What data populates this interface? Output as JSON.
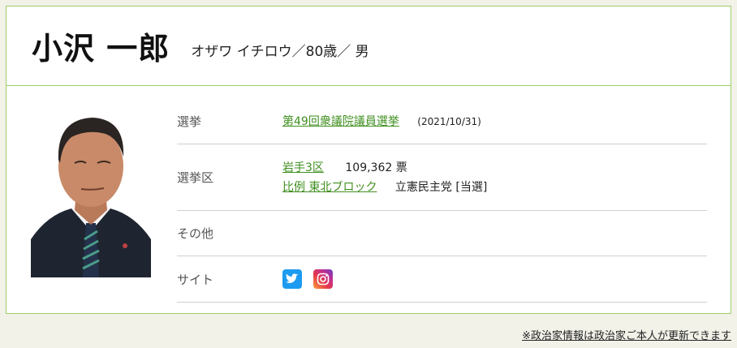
{
  "header": {
    "name": "小沢 一郎",
    "kana_age_gender": "オザワ イチロウ／80歳／ 男"
  },
  "profile": {
    "rows": [
      {
        "label": "選挙",
        "election_link": "第49回衆議院議員選挙",
        "election_date": "(2021/10/31)"
      },
      {
        "label": "選挙区",
        "district_link": "岩手3区",
        "district_votes": "109,362 票",
        "pr_link": "比例 東北ブロック",
        "pr_party": "立憲民主党 [当選]"
      },
      {
        "label": "その他"
      },
      {
        "label": "サイト",
        "sns": [
          "twitter-icon",
          "instagram-icon"
        ]
      }
    ]
  },
  "footnote": "※政治家情報は政治家ご本人が更新できます",
  "colors": {
    "accent_green": "#3f8f1f",
    "border_green": "#9ccf6b",
    "background": "#f2f2e9",
    "twitter_blue": "#1d9bf0"
  }
}
